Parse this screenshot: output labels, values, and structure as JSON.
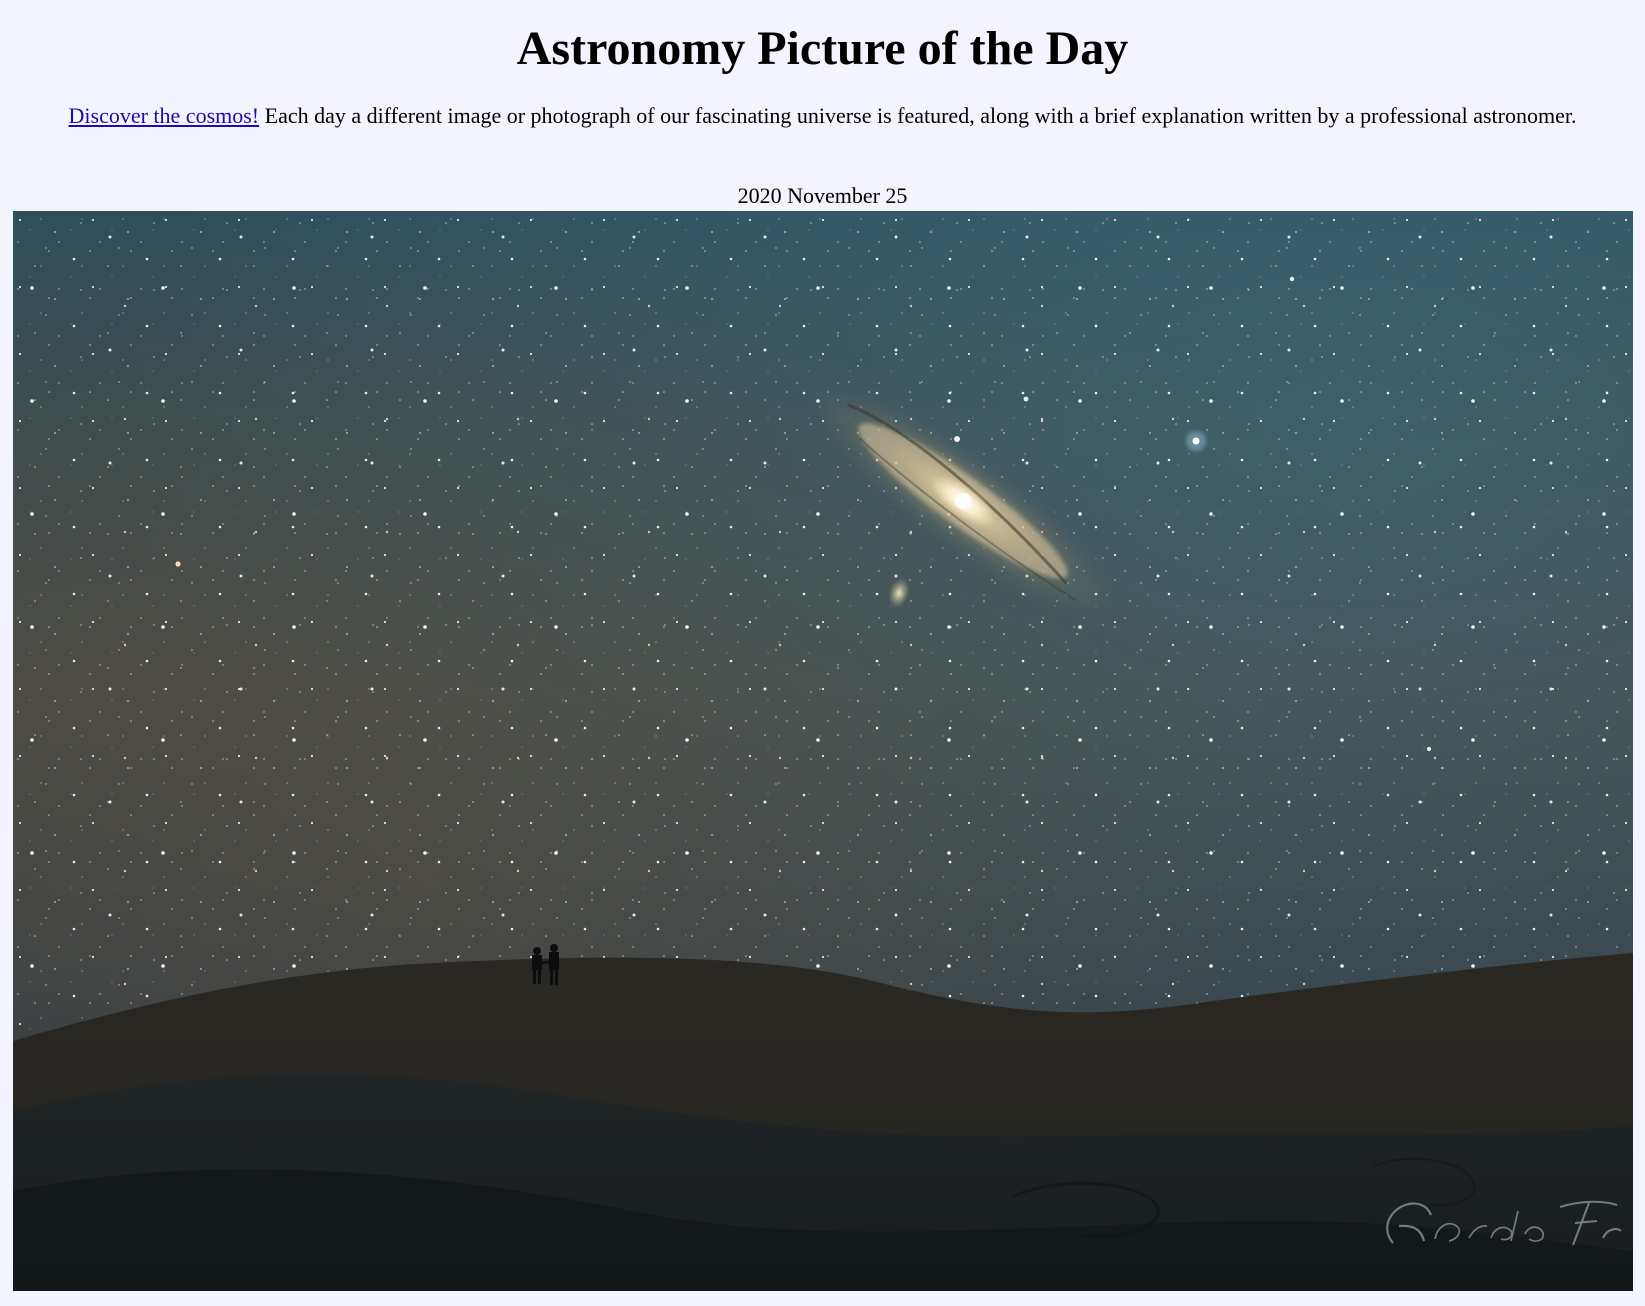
{
  "page": {
    "title": "Astronomy Picture of the Day",
    "intro": {
      "link_text": "Discover the cosmos!",
      "text": " Each day a different image or photograph of our fascinating universe is featured, along with a brief explanation written by a professional astronomer."
    },
    "date": "2020 November 25"
  },
  "image": {
    "photo_credit_watermark": "Gerardo Ferrarino"
  }
}
